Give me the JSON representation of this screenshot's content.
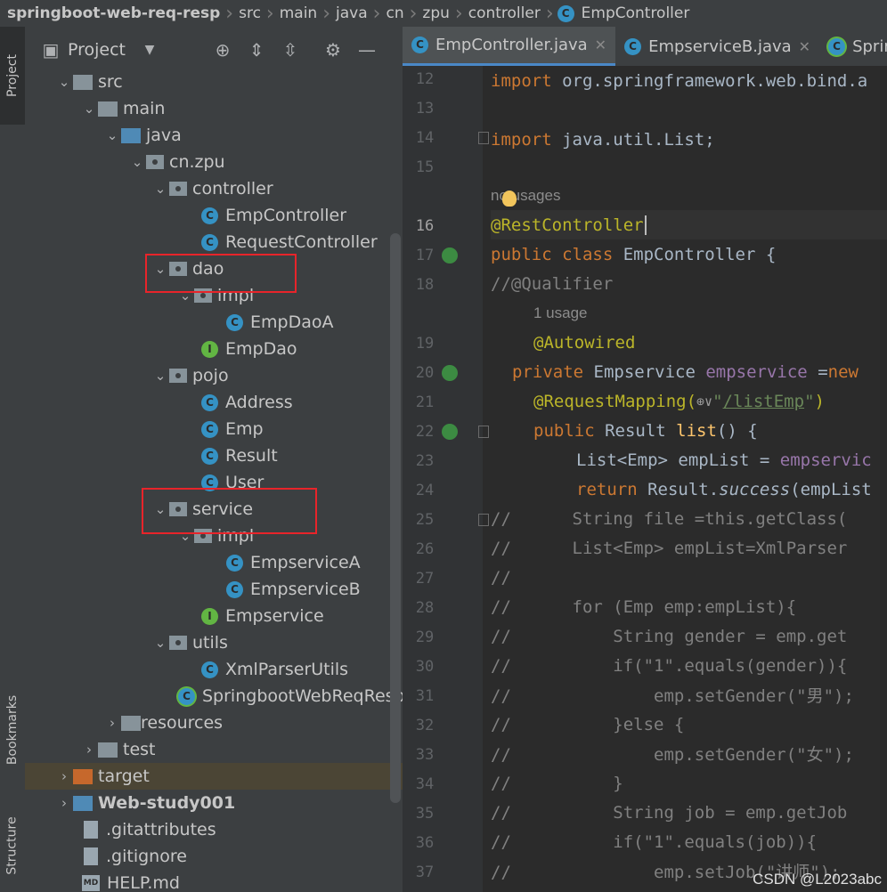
{
  "breadcrumb": [
    "springboot-web-req-resp",
    "src",
    "main",
    "java",
    "cn",
    "zpu",
    "controller",
    "EmpController"
  ],
  "left_strip": {
    "project": "Project",
    "bookmarks": "Bookmarks",
    "structure": "Structure"
  },
  "project_panel": {
    "title": "Project",
    "tree": {
      "src": "src",
      "main": "main",
      "java": "java",
      "cn_zpu": "cn.zpu",
      "controller": "controller",
      "EmpController": "EmpController",
      "RequestController": "RequestController",
      "dao": "dao",
      "dao_impl": "impl",
      "EmpDaoA": "EmpDaoA",
      "EmpDao": "EmpDao",
      "pojo": "pojo",
      "Address": "Address",
      "Emp": "Emp",
      "Result": "Result",
      "User": "User",
      "service": "service",
      "service_impl": "impl",
      "EmpserviceA": "EmpserviceA",
      "EmpserviceB": "EmpserviceB",
      "Empservice": "Empservice",
      "utils": "utils",
      "XmlParserUtils": "XmlParserUtils",
      "SpringbootWebReqRespA": "SpringbootWebReqRespA",
      "resources": "resources",
      "test": "test",
      "target": "target",
      "web_study": "Web-study001",
      "gitattributes": ".gitattributes",
      "gitignore": ".gitignore",
      "help": "HELP.md",
      "md_badge": "MD"
    }
  },
  "tabs": [
    {
      "label": "EmpController.java",
      "active": true
    },
    {
      "label": "EmpserviceB.java",
      "active": false
    },
    {
      "label": "Sprin",
      "active": false
    }
  ],
  "editor": {
    "line_numbers": [
      "12",
      "13",
      "14",
      "15",
      "16",
      "17",
      "18",
      "19",
      "20",
      "21",
      "22",
      "23",
      "24",
      "25",
      "26",
      "27",
      "28",
      "29",
      "30",
      "31",
      "32",
      "33",
      "34",
      "35",
      "36",
      "37"
    ],
    "hints": {
      "no_usages": "no usages",
      "one_usage": "1 usage"
    },
    "code": {
      "l12_kw": "import",
      "l12_rest": " org.springframework.web.bind.a",
      "l14_kw": "import",
      "l14_rest": " java.util.List;",
      "l16": "@RestController",
      "l17_kw": "public class",
      "l17_rest": " EmpController {",
      "l18": "//@Qualifier",
      "l19": "@Autowired",
      "l20_kw": "private",
      "l20_type": " Empservice ",
      "l20_field": "empservice",
      "l20_eq": " =",
      "l20_new": "new",
      "l21_ann": "@RequestMapping(",
      "l21_globe": "⊕∨",
      "l21_q1": "\"",
      "l21_path": "/listEmp",
      "l21_q2": "\"",
      "l21_close": ")",
      "l22_kw": "public",
      "l22_type": " Result ",
      "l22_method": "list",
      "l22_rest": "() {",
      "l23_a": "List<Emp> empList = ",
      "l23_field": "empservic",
      "l24_kw": "return",
      "l24_a": " Result.",
      "l24_method": "success",
      "l24_b": "(empList",
      "l25": "//      String file =this.getClass(",
      "l26": "//      List<Emp> empList=XmlParser",
      "l27": "//",
      "l28": "//      for (Emp emp:empList){",
      "l29": "//          String gender = emp.get",
      "l30": "//          if(\"1\".equals(gender)){",
      "l31": "//              emp.setGender(\"男\");",
      "l32": "//          }else {",
      "l33": "//              emp.setGender(\"女\");",
      "l34": "//          }",
      "l35": "//          String job = emp.getJob",
      "l36": "//          if(\"1\".equals(job)){",
      "l37": "//              emp.setJob(\"讲师\");"
    }
  },
  "watermark": "CSDN @L2023abc",
  "colors": {
    "highlight_box": "#e8242a",
    "keyword": "#cc7832",
    "annotation": "#bbb529",
    "comment": "#808080",
    "string": "#6a8759"
  }
}
